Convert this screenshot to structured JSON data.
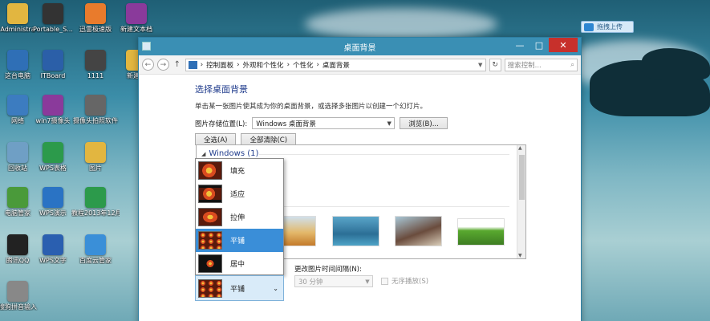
{
  "desktop": {
    "icons": [
      {
        "label": "Administra",
        "icon": "folder-icon",
        "color": "#e2b640"
      },
      {
        "label": "Portable_S...",
        "icon": "usb-drive-icon",
        "color": "#333333"
      },
      {
        "label": "迅雷极速版",
        "icon": "thunder-icon",
        "color": "#e97b2c"
      },
      {
        "label": "新建文本档",
        "icon": "archive-icon",
        "color": "#8a3a9b"
      },
      {
        "label": "这台电脑",
        "icon": "computer-icon",
        "color": "#2f6fb6"
      },
      {
        "label": "ITBoard",
        "icon": "itboard-icon",
        "color": "#2b5fa8"
      },
      {
        "label": "1111",
        "icon": "video-icon",
        "color": "#444444"
      },
      {
        "label": "新建文",
        "icon": "folder-icon",
        "color": "#e2b640"
      },
      {
        "label": "网络",
        "icon": "network-icon",
        "color": "#3c7cc0"
      },
      {
        "label": "win7摄像头",
        "icon": "archive-icon",
        "color": "#8a3a9b"
      },
      {
        "label": "摄像头拍照软件",
        "icon": "camera-icon",
        "color": "#666666"
      },
      {
        "label": "回收站",
        "icon": "recycle-bin-icon",
        "color": "#6f9fc5"
      },
      {
        "label": "WPS表格",
        "icon": "wps-sheet-icon",
        "color": "#2c9a4b"
      },
      {
        "label": "图片",
        "icon": "folder-icon",
        "color": "#e2b640"
      },
      {
        "label": "电脑管家",
        "icon": "shield-icon",
        "color": "#4a9a3a"
      },
      {
        "label": "WPS演示",
        "icon": "wps-slide-icon",
        "color": "#2a73c4"
      },
      {
        "label": "教程2013年12月...",
        "icon": "excel-icon",
        "color": "#2c9a4b"
      },
      {
        "label": "腾讯QQ",
        "icon": "qq-icon",
        "color": "#222222"
      },
      {
        "label": "WPS文字",
        "icon": "wps-doc-icon",
        "color": "#2a5fb0"
      },
      {
        "label": "百度云管家",
        "icon": "cloud-icon",
        "color": "#3a8fd8"
      },
      {
        "label": "搜狗拼音输入",
        "icon": "pen-icon",
        "color": "#888888"
      }
    ],
    "upload_badge": "拖拽上传"
  },
  "window": {
    "title": "桌面背景",
    "controls": {
      "minimize": "—",
      "maximize": "□",
      "close": "✕"
    },
    "nav": {
      "back": "←",
      "forward": "→",
      "up": "↑",
      "refresh": "↻"
    },
    "breadcrumb": [
      "控制面板",
      "外观和个性化",
      "个性化",
      "桌面背景"
    ],
    "breadcrumb_sep": "›",
    "search_placeholder": "搜索控制...",
    "heading": "选择桌面背景",
    "description": "单击某一张图片使其成为你的桌面背景，或选择多张图片以创建一个幻灯片。",
    "location_label": "图片存储位置(L):",
    "location_value": "Windows 桌面背景",
    "browse_button": "浏览(B)...",
    "select_all_button": "全选(A)",
    "clear_all_button": "全部清除(C)",
    "group_title": "Windows (1)",
    "interval_label": "更改图片时间间隔(N):",
    "interval_value": "30 分钟",
    "shuffle_label": "无序播放(S)",
    "positions": [
      "填充",
      "适应",
      "拉伸",
      "平铺",
      "居中"
    ],
    "selected_position": "平铺"
  }
}
